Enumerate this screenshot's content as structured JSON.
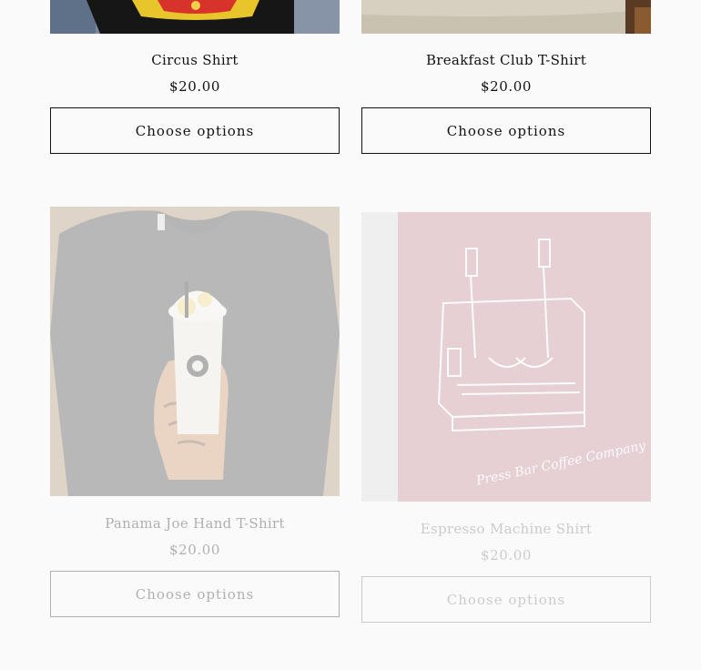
{
  "products": [
    {
      "title": "Circus Shirt",
      "price": "$20.00",
      "button": "Choose options"
    },
    {
      "title": "Breakfast Club T-Shirt",
      "price": "$20.00",
      "button": "Choose options"
    },
    {
      "title": "Panama Joe Hand T-Shirt",
      "price": "$20.00",
      "button": "Choose options"
    },
    {
      "title": "Espresso Machine Shirt",
      "price": "$20.00",
      "button": "Choose options",
      "image_script_text": "Press Bar Coffee Company"
    }
  ]
}
